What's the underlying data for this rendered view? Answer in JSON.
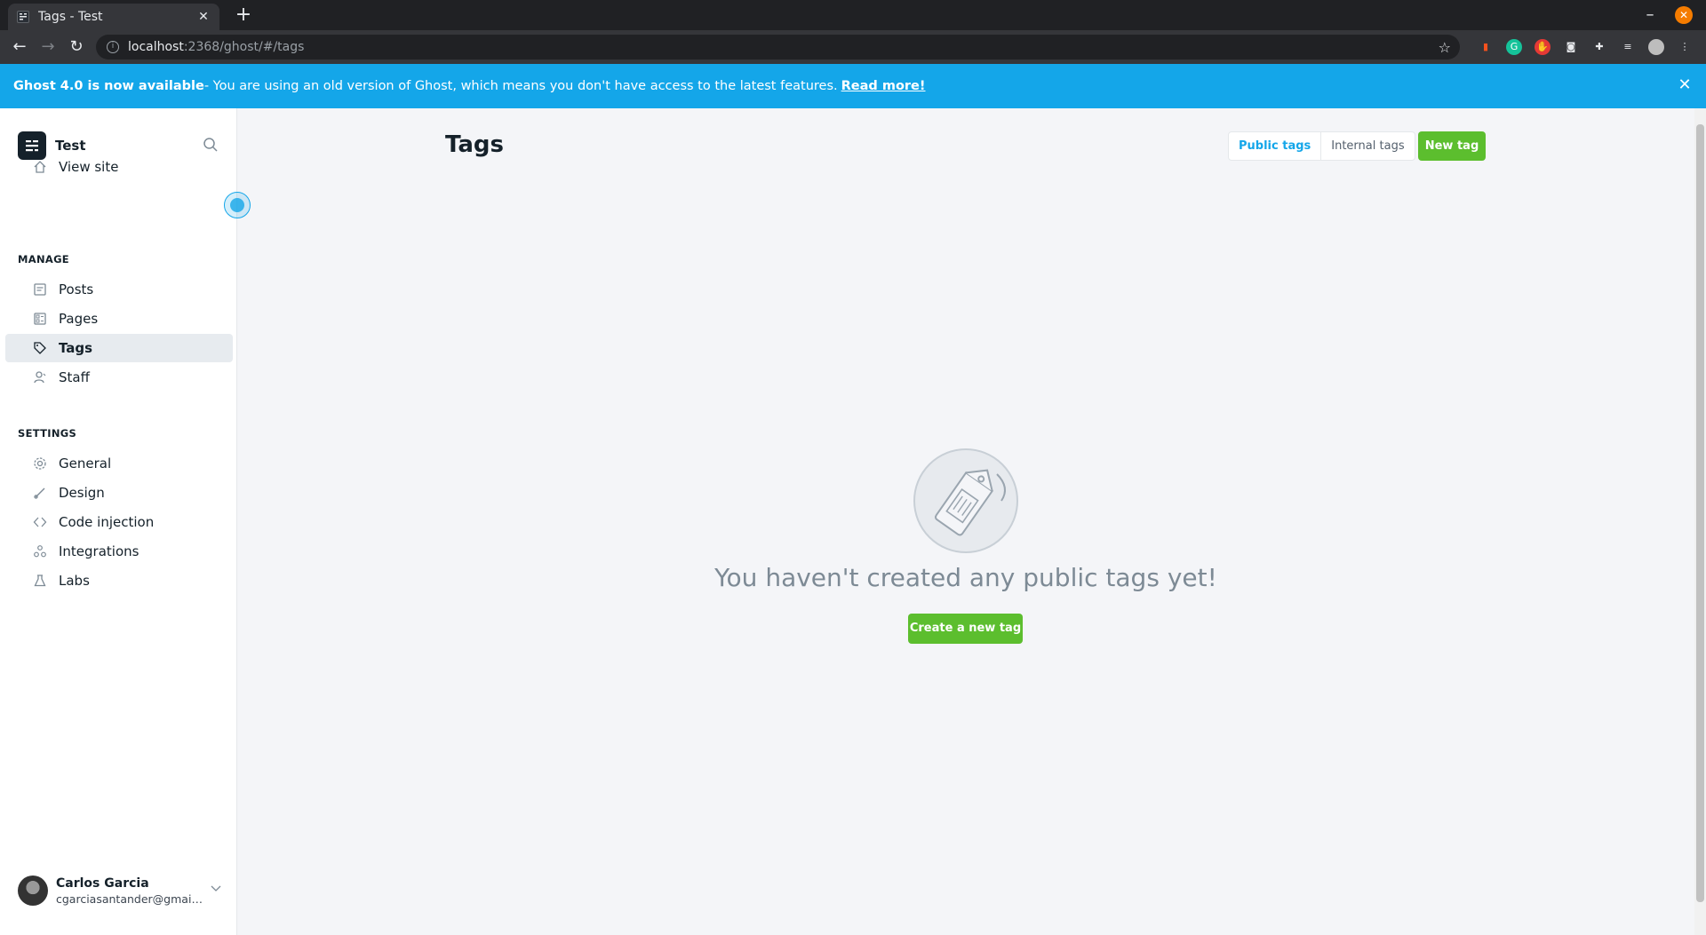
{
  "browser": {
    "tab_title": "Tags - Test",
    "tab_close": "✕",
    "new_tab": "+",
    "url_host": "localhost",
    "url_path": ":2368/ghost/#/tags"
  },
  "banner": {
    "headline": "Ghost 4.0 is now available",
    "message": " - You are using an old version of Ghost, which means you don't have access to the latest features.",
    "link": "Read more!"
  },
  "sidebar": {
    "site_name": "Test",
    "view_site": "View site",
    "manage_label": "MANAGE",
    "manage_items": [
      {
        "label": "Posts",
        "icon": "posts-icon"
      },
      {
        "label": "Pages",
        "icon": "pages-icon"
      },
      {
        "label": "Tags",
        "icon": "tag-icon",
        "active": true
      },
      {
        "label": "Staff",
        "icon": "staff-icon"
      }
    ],
    "settings_label": "SETTINGS",
    "settings_items": [
      {
        "label": "General",
        "icon": "gear-icon"
      },
      {
        "label": "Design",
        "icon": "brush-icon"
      },
      {
        "label": "Code injection",
        "icon": "code-icon"
      },
      {
        "label": "Integrations",
        "icon": "integrations-icon"
      },
      {
        "label": "Labs",
        "icon": "flask-icon"
      }
    ],
    "user": {
      "name": "Carlos Garcia",
      "email": "cgarciasantander@gmail...."
    }
  },
  "main": {
    "title": "Tags",
    "filter_public": "Public tags",
    "filter_internal": "Internal tags",
    "new_tag": "New tag",
    "empty_message": "You haven't created any public tags yet!",
    "create_button": "Create a new tag"
  },
  "colors": {
    "accent_blue": "#14a6e9",
    "primary_green": "#5cbe2e",
    "text_dark": "#15212a",
    "background": "#f4f5f8"
  }
}
